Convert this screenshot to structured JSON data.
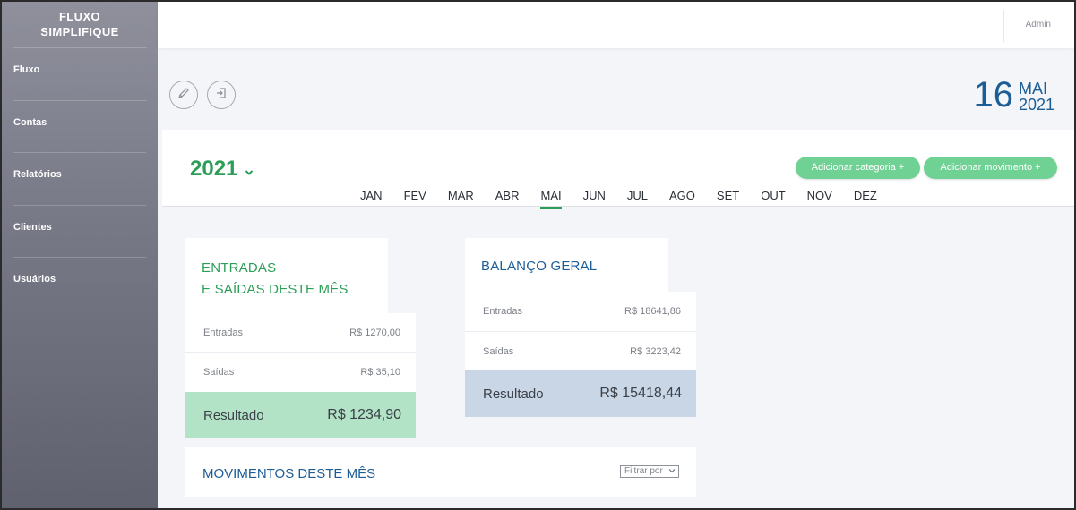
{
  "app": {
    "brand_line1": "FLUXO",
    "brand_line2": "SIMPLIFIQUE"
  },
  "sidebar": {
    "items": [
      {
        "label": "Fluxo"
      },
      {
        "label": "Contas"
      },
      {
        "label": "Relatórios"
      },
      {
        "label": "Clientes"
      },
      {
        "label": "Usuários"
      }
    ]
  },
  "topbar": {
    "user": "Admin"
  },
  "toolbar": {
    "edit_icon": "pencil-icon",
    "exit_icon": "sign-in-icon"
  },
  "date": {
    "day": "16",
    "month": "MAI",
    "year": "2021"
  },
  "period": {
    "year": "2021",
    "months": [
      "JAN",
      "FEV",
      "MAR",
      "ABR",
      "MAI",
      "JUN",
      "JUL",
      "AGO",
      "SET",
      "OUT",
      "NOV",
      "DEZ"
    ],
    "active_month": "MAI",
    "add_category": "Adicionar categoria +",
    "add_movement": "Adicionar movimento +"
  },
  "monthly": {
    "title_line1": "ENTRADAS",
    "title_line2": "E SAÍDAS DESTE MÊS",
    "entradas_label": "Entradas",
    "entradas_value": "R$ 1270,00",
    "saidas_label": "Saídas",
    "saidas_value": "R$ 35,10",
    "result_label": "Resultado",
    "result_value": "R$ 1234,90"
  },
  "balance": {
    "title": "BALANÇO GERAL",
    "entradas_label": "Entradas",
    "entradas_value": "R$ 18641,86",
    "saidas_label": "Saídas",
    "saidas_value": "R$ 3223,42",
    "result_label": "Resultado",
    "result_value": "R$ 15418,44"
  },
  "movements": {
    "title": "MOVIMENTOS DESTE MÊS",
    "filter_placeholder": "Filtrar por"
  },
  "colors": {
    "green": "#2c9e57",
    "blue": "#1d5d96",
    "green_result": "#b3e3c6",
    "blue_result": "#c9d6e6",
    "pill": "#70d194"
  }
}
